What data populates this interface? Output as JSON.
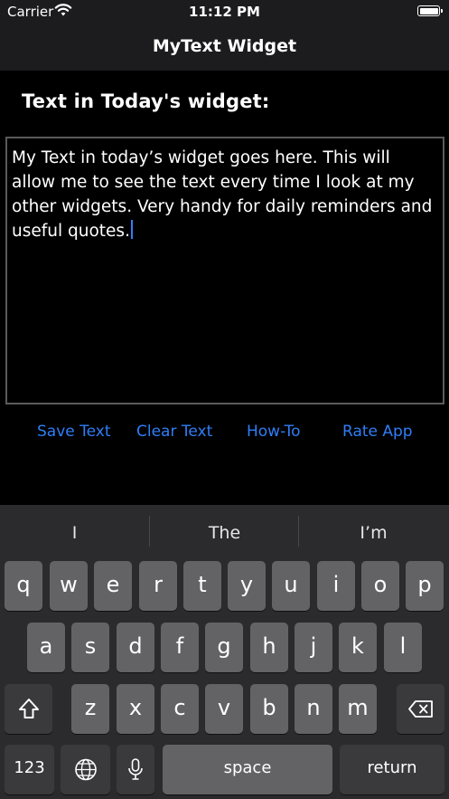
{
  "status_bar": {
    "carrier": "Carrier",
    "time": "11:12 PM"
  },
  "nav": {
    "title": "MyText Widget"
  },
  "section_label": "Text in Today's widget:",
  "text_area": {
    "value": "My Text in today’s widget goes here. This will allow me to see the text every time I look at my other widgets. Very handy for daily reminders and useful quotes."
  },
  "actions": {
    "save": "Save Text",
    "clear": "Clear Text",
    "howto": "How-To",
    "rate": "Rate App"
  },
  "keyboard": {
    "suggestions": [
      "I",
      "The",
      "I’m"
    ],
    "row1": [
      "q",
      "w",
      "e",
      "r",
      "t",
      "y",
      "u",
      "i",
      "o",
      "p"
    ],
    "row2": [
      "a",
      "s",
      "d",
      "f",
      "g",
      "h",
      "j",
      "k",
      "l"
    ],
    "row3": [
      "z",
      "x",
      "c",
      "v",
      "b",
      "n",
      "m"
    ],
    "numbers_label": "123",
    "space_label": "space",
    "return_label": "return"
  },
  "icons": {
    "wifi": "wifi-icon",
    "battery": "battery-icon",
    "shift": "shift-icon",
    "backspace": "backspace-icon",
    "globe": "globe-icon",
    "mic": "microphone-icon"
  },
  "colors": {
    "accent": "#2f7ef7",
    "background": "#000000",
    "bar": "#1c1c1e",
    "keyboard_bg": "#2b2b2d",
    "key": "#636366",
    "function_key": "#3a3a3c"
  }
}
